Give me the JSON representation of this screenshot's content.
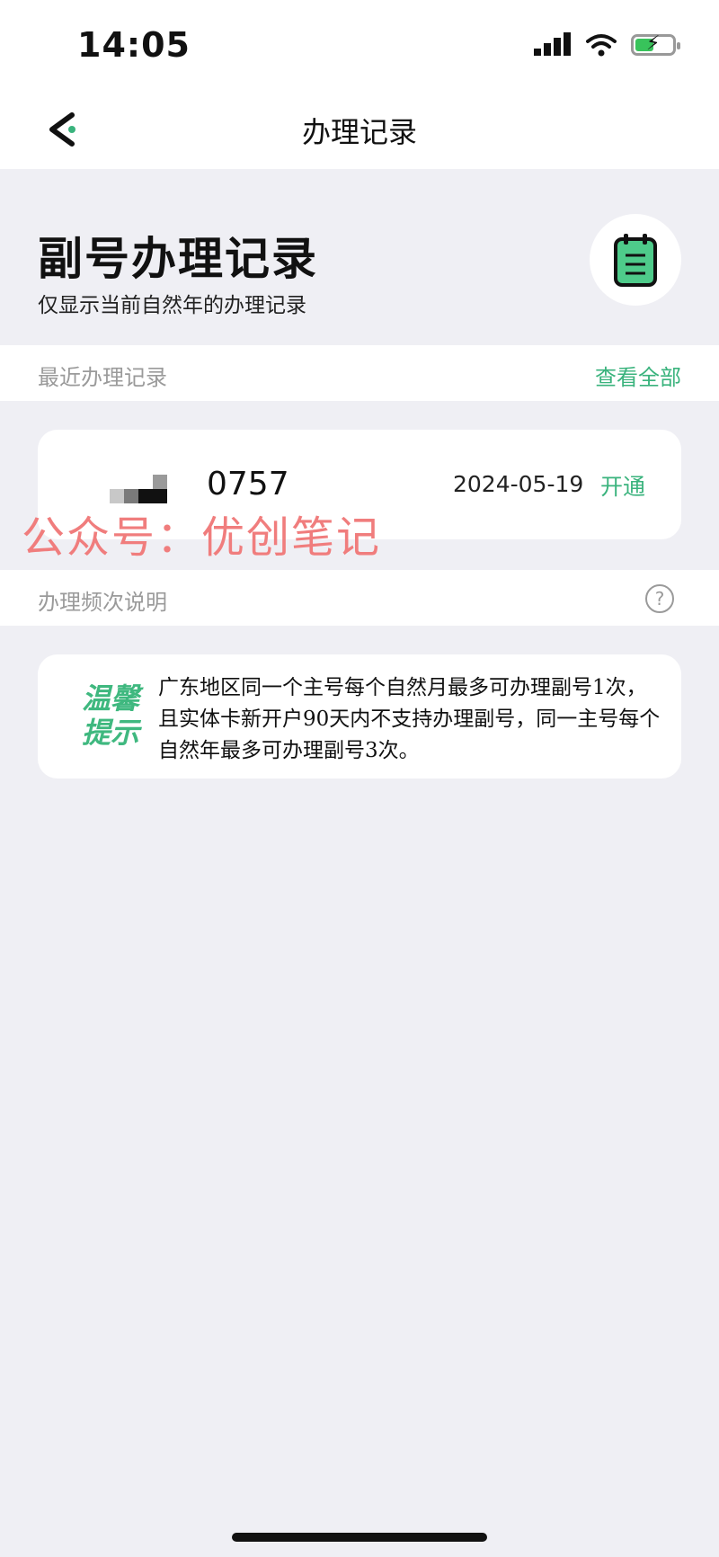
{
  "status_bar": {
    "time": "14:05",
    "icons": [
      "signal-icon",
      "wifi-icon",
      "battery-charging-icon"
    ],
    "battery_color": "#38c35b"
  },
  "nav": {
    "title": "办理记录",
    "back_icon": "chevron-left-icon"
  },
  "header": {
    "title": "副号办理记录",
    "subtitle": "仅显示当前自然年的办理记录",
    "icon": "notepad-icon"
  },
  "recent_section": {
    "label": "最近办理记录",
    "action": "查看全部"
  },
  "record": {
    "number_suffix": "0757",
    "date": "2024-05-19",
    "status": "开通"
  },
  "watermark": "公众号：优创笔记",
  "frequency_section": {
    "label": "办理频次说明",
    "help_icon": "question-circle-icon",
    "help_symbol": "?"
  },
  "tip": {
    "badge_line1": "温馨",
    "badge_line2": "提示",
    "text": "广东地区同一个主号每个自然月最多可办理副号1次，且实体卡新开户90天内不支持办理副号，同一主号每个自然年最多可办理副号3次。"
  },
  "colors": {
    "accent": "#3ab37d",
    "background": "#efeff4",
    "watermark": "#f07d7d"
  }
}
